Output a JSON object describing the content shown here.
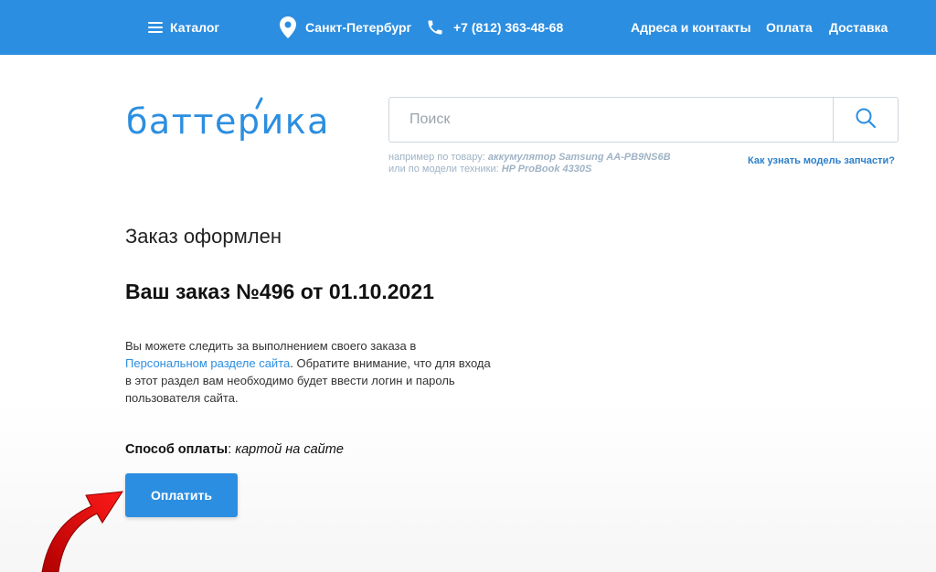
{
  "header": {
    "catalog_label": "Каталог",
    "city": "Санкт-Петербург",
    "phone": "+7 (812) 363-48-68",
    "nav": [
      "Адреса и контакты",
      "Оплата",
      "Доставка"
    ],
    "background_color": "#2c8ee0"
  },
  "logo": {
    "text": "баттерика",
    "color": "#2c8ee0"
  },
  "search": {
    "placeholder": "Поиск",
    "hint_line1_prefix": "например по товару: ",
    "hint_line1_example": "аккумулятор Samsung AA-PB9NS6B",
    "hint_line2_prefix": "или по модели техники: ",
    "hint_line2_example": "HP ProBook 4330S",
    "howto_link": "Как узнать модель запчасти?"
  },
  "order": {
    "status": "Заказ оформлен",
    "title": "Ваш заказ №496 от 01.10.2021",
    "text_before_link": "Вы можете следить за выполнением своего заказа в ",
    "link_text": "Персональном разделе сайта",
    "text_after_link": ". Обратите внимание, что для входа в этот раздел вам необходимо будет ввести логин и пароль пользователя сайта.",
    "payment_label": "Способ оплаты",
    "payment_separator": ": ",
    "payment_value": "картой на сайте",
    "pay_button": "Оплатить"
  },
  "colors": {
    "accent": "#2c8ee0",
    "arrow": "#e01010"
  }
}
